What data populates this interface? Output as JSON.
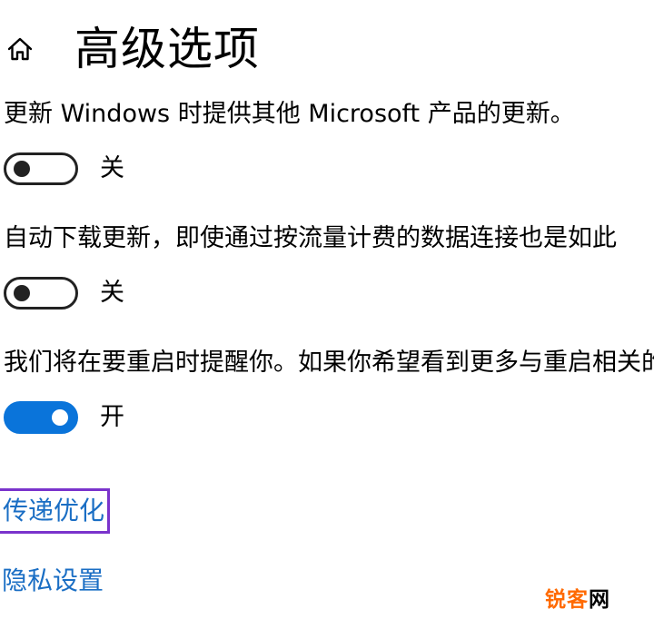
{
  "header": {
    "title": "高级选项",
    "home_icon": "home-icon"
  },
  "settings": [
    {
      "description": "更新 Windows 时提供其他 Microsoft 产品的更新。",
      "toggle_state": "off",
      "state_label": "关"
    },
    {
      "description": "自动下载更新，即使通过按流量计费的数据连接也是如此",
      "toggle_state": "off",
      "state_label": "关"
    },
    {
      "description": "我们将在要重启时提醒你。如果你希望看到更多与重启相关的",
      "toggle_state": "on",
      "state_label": "开"
    }
  ],
  "links": {
    "delivery_optimization": "传递优化",
    "privacy_settings": "隐私设置"
  },
  "watermark": {
    "part1": "锐客",
    "part2": "网"
  },
  "colors": {
    "accent": "#0a74da",
    "link": "#1a6ec4",
    "focus_outline": "#7a33cc",
    "watermark": "#ff6a00"
  }
}
